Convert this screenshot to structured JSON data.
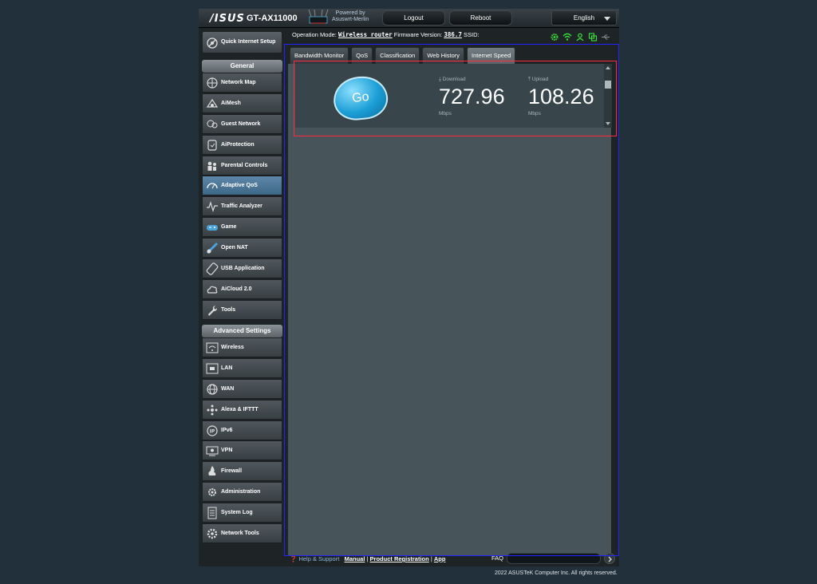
{
  "header": {
    "logo": "/ISUS",
    "model": "GT-AX11000",
    "powered_by_line1": "Powered by",
    "powered_by_line2": "Asuswrt-Merlin",
    "logout_label": "Logout",
    "reboot_label": "Reboot",
    "language": "English"
  },
  "opbar": {
    "mode_label": "Operation Mode:",
    "mode_value": "Wireless router",
    "firmware_label": "Firmware Version:",
    "firmware_value": "386.7",
    "ssid_label": "SSID:"
  },
  "status_icons": [
    "gear-icon",
    "wifi-icon",
    "user-icon",
    "copy-icon",
    "usb-icon"
  ],
  "sidebar": {
    "quick_setup": "Quick Internet Setup",
    "general_header": "General",
    "general_items": [
      {
        "label": "Network Map",
        "icon": "network-map-icon"
      },
      {
        "label": "AiMesh",
        "icon": "aimesh-icon"
      },
      {
        "label": "Guest Network",
        "icon": "guest-network-icon"
      },
      {
        "label": "AiProtection",
        "icon": "shield-icon"
      },
      {
        "label": "Parental Controls",
        "icon": "parental-icon"
      },
      {
        "label": "Adaptive QoS",
        "icon": "qos-icon",
        "active": true
      },
      {
        "label": "Traffic Analyzer",
        "icon": "analyzer-icon"
      },
      {
        "label": "Game",
        "icon": "gamepad-icon"
      },
      {
        "label": "Open NAT",
        "icon": "open-nat-icon"
      },
      {
        "label": "USB Application",
        "icon": "usb-app-icon"
      },
      {
        "label": "AiCloud 2.0",
        "icon": "cloud-icon"
      },
      {
        "label": "Tools",
        "icon": "wrench-icon"
      }
    ],
    "advanced_header": "Advanced Settings",
    "advanced_items": [
      {
        "label": "Wireless",
        "icon": "wireless-icon"
      },
      {
        "label": "LAN",
        "icon": "lan-icon"
      },
      {
        "label": "WAN",
        "icon": "globe-icon"
      },
      {
        "label": "Alexa & IFTTT",
        "icon": "alexa-icon"
      },
      {
        "label": "IPv6",
        "icon": "ipv6-icon"
      },
      {
        "label": "VPN",
        "icon": "vpn-icon"
      },
      {
        "label": "Firewall",
        "icon": "firewall-icon"
      },
      {
        "label": "Administration",
        "icon": "admin-icon"
      },
      {
        "label": "System Log",
        "icon": "system-log-icon"
      },
      {
        "label": "Network Tools",
        "icon": "network-tools-icon"
      }
    ]
  },
  "tabs": [
    {
      "label": "Bandwidth Monitor"
    },
    {
      "label": "QoS"
    },
    {
      "label": "Classification"
    },
    {
      "label": "Web History"
    },
    {
      "label": "Internet Speed",
      "active": true
    }
  ],
  "speedtest": {
    "go_label": "Go",
    "download_label": "Download",
    "download_value": "727.96",
    "download_unit": "Mbps",
    "upload_label": "Upload",
    "upload_value": "108.26",
    "upload_unit": "Mbps"
  },
  "footer": {
    "help": "Help & Support",
    "manual": "Manual",
    "registration": "Product Registration",
    "app": "App",
    "faq": "FAQ",
    "copyright": "2022 ASUSTeK Computer Inc. All rights reserved."
  },
  "colors": {
    "accent_blue": "#1b9fd6",
    "active_menu": "#4a7597",
    "status_green": "#39e43a",
    "overlay_blue": "#2323ff",
    "overlay_red": "#ff2a3c"
  }
}
